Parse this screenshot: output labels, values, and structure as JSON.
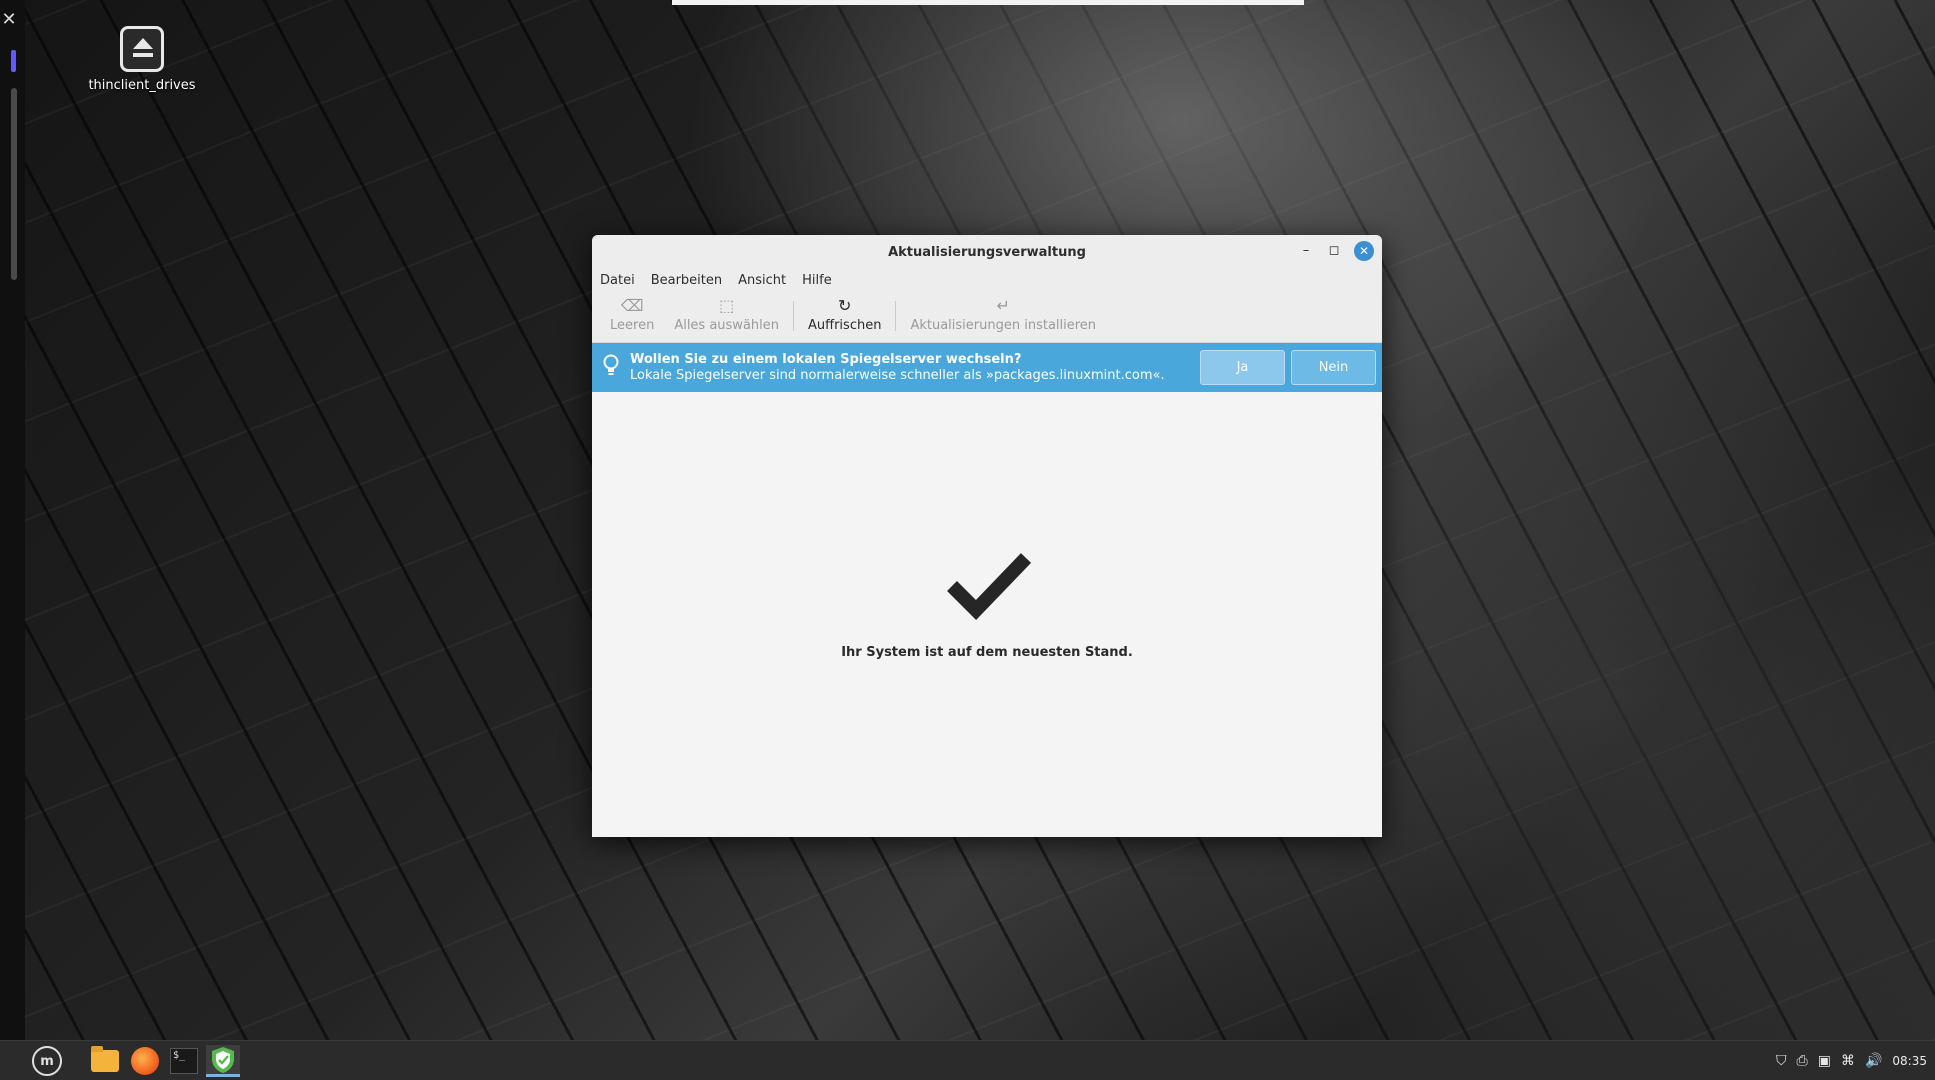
{
  "desktop": {
    "icon_label": "thinclient_drives"
  },
  "window": {
    "title": "Aktualisierungsverwaltung",
    "menu": [
      "Datei",
      "Bearbeiten",
      "Ansicht",
      "Hilfe"
    ],
    "toolbar": {
      "clear": "Leeren",
      "select_all": "Alles auswählen",
      "refresh": "Auffrischen",
      "install": "Aktualisierungen installieren"
    },
    "infobar": {
      "headline": "Wollen Sie zu einem lokalen Spiegelserver wechseln?",
      "detail": "Lokale Spiegelserver sind normalerweise schneller als »packages.linuxmint.com«.",
      "yes_label": "Ja",
      "no_label": "Nein",
      "color": "#4aa7dc"
    },
    "status_message": "Ihr System ist auf dem neuesten Stand."
  },
  "taskbar": {
    "clock": "08:35",
    "accent": "#7fb0e0"
  }
}
